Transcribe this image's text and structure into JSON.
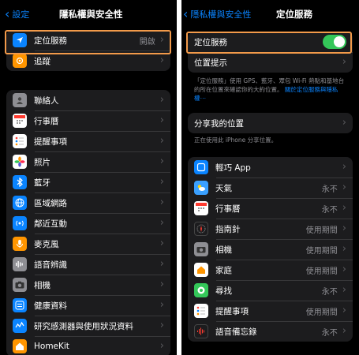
{
  "left": {
    "back_label": "設定",
    "title": "隱私權與安全性",
    "group1": [
      {
        "label": "定位服務",
        "value": "開啟",
        "icon": "location-arrow-icon",
        "color": "#0a84ff"
      },
      {
        "label": "追蹤",
        "icon": "tracking-icon",
        "color": "#ff9500"
      }
    ],
    "group2": [
      {
        "label": "聯絡人",
        "icon": "contacts-icon",
        "color": "#8e8e93"
      },
      {
        "label": "行事曆",
        "icon": "calendar-icon",
        "color": "#ffffff"
      },
      {
        "label": "提醒事項",
        "icon": "reminders-icon",
        "color": "#ffffff"
      },
      {
        "label": "照片",
        "icon": "photos-icon",
        "color": "#ffffff"
      },
      {
        "label": "藍牙",
        "icon": "bluetooth-icon",
        "color": "#0a84ff"
      },
      {
        "label": "區域網路",
        "icon": "local-network-icon",
        "color": "#0a84ff"
      },
      {
        "label": "鄰近互動",
        "icon": "nearby-interactions-icon",
        "color": "#0a84ff"
      },
      {
        "label": "麥克風",
        "icon": "microphone-icon",
        "color": "#ff9500"
      },
      {
        "label": "語音辨識",
        "icon": "speech-recognition-icon",
        "color": "#8e8e93"
      },
      {
        "label": "相機",
        "icon": "camera-icon",
        "color": "#8e8e93"
      },
      {
        "label": "健康資料",
        "icon": "health-icon",
        "color": "#0a84ff"
      },
      {
        "label": "研究感測器與使用狀況資料",
        "icon": "research-sensor-icon",
        "color": "#0a84ff"
      },
      {
        "label": "HomeKit",
        "icon": "homekit-icon",
        "color": "#ff9500"
      }
    ]
  },
  "right": {
    "back_label": "隱私權與安全性",
    "title": "定位服務",
    "location_services_label": "定位服務",
    "location_alerts_label": "位置提示",
    "note_text": "「定位服務」使用 GPS、藍牙、眾包 Wi-Fi 熱點和基地台的所在位置來確認你的大約位置。",
    "note_link": "關於定位服務與隱私權⋯",
    "share_location_label": "分享我的位置",
    "share_note": "正在使用此 iPhone 分享位置。",
    "apps": [
      {
        "label": "輕巧 App",
        "value": "",
        "icon": "app-clips-icon",
        "color": "#0a84ff"
      },
      {
        "label": "天氣",
        "value": "永不",
        "icon": "weather-icon",
        "color": "#3aa0ff"
      },
      {
        "label": "行事曆",
        "value": "永不",
        "icon": "calendar-icon",
        "color": "#ffffff"
      },
      {
        "label": "指南針",
        "value": "使用期間",
        "icon": "compass-icon",
        "color": "#1c1c1e"
      },
      {
        "label": "相機",
        "value": "使用期間",
        "icon": "camera-icon",
        "color": "#8e8e93"
      },
      {
        "label": "家庭",
        "value": "使用期間",
        "icon": "home-icon",
        "color": "#ffffff"
      },
      {
        "label": "尋找",
        "value": "永不",
        "icon": "find-my-icon",
        "color": "#34c759"
      },
      {
        "label": "提醒事項",
        "value": "使用期間",
        "icon": "reminders-icon",
        "color": "#ffffff"
      },
      {
        "label": "語音備忘錄",
        "value": "永不",
        "icon": "voice-memos-icon",
        "color": "#1c1c1e"
      }
    ]
  }
}
